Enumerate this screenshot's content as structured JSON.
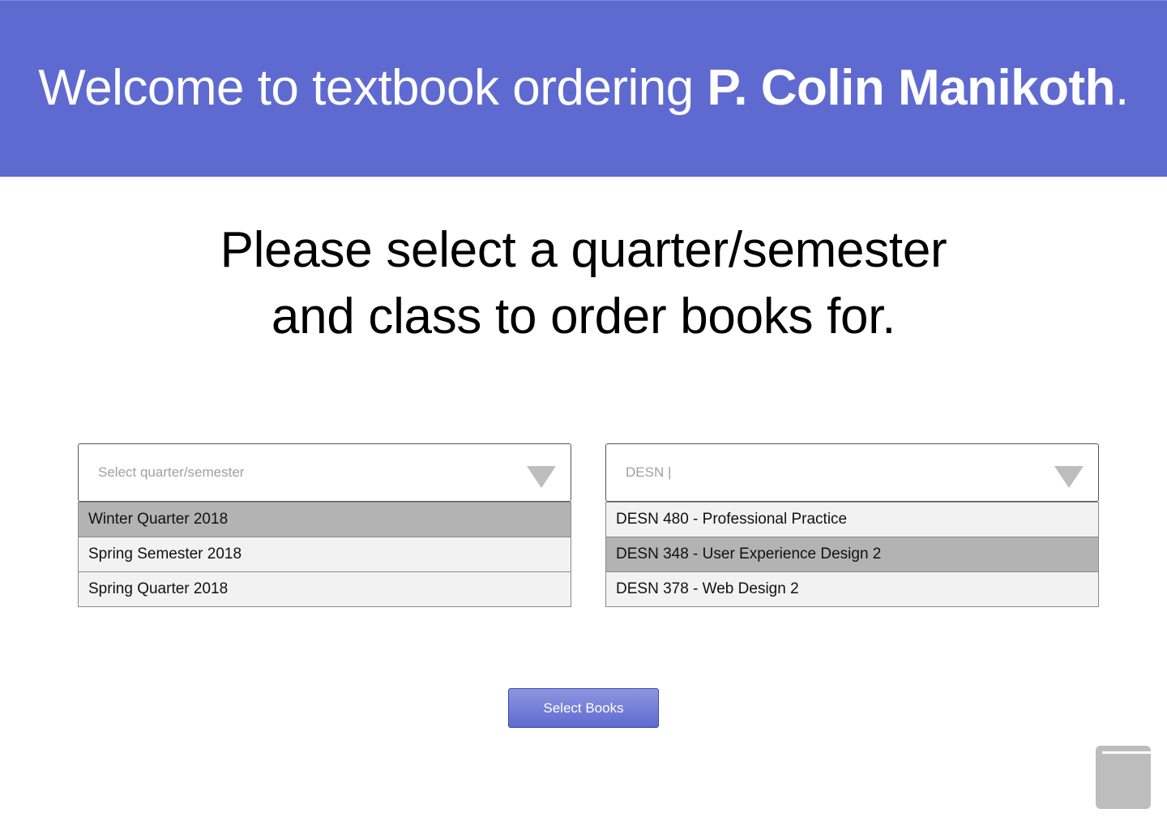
{
  "header": {
    "welcome_text": "Welcome to textbook ordering ",
    "user_name": "P. Colin Manikoth",
    "punctuation": "."
  },
  "instructions": {
    "line1": "Please select a quarter/semester",
    "line2": "and class to order books for."
  },
  "term_dropdown": {
    "placeholder": "Select quarter/semester",
    "options": [
      {
        "label": "Winter Quarter 2018",
        "selected": true
      },
      {
        "label": "Spring Semester 2018",
        "selected": false
      },
      {
        "label": "Spring Quarter 2018",
        "selected": false
      }
    ]
  },
  "class_dropdown": {
    "value": "DESN |",
    "options": [
      {
        "label": "DESN 480 - Professional Practice",
        "selected": false
      },
      {
        "label": "DESN 348 - User Experience Design 2",
        "selected": true
      },
      {
        "label": "DESN 378 - Web Design 2",
        "selected": false
      }
    ]
  },
  "actions": {
    "select_books_label": "Select Books"
  },
  "icons": {
    "dropdown_arrow": "chevron-down-icon",
    "corner": "book-icon"
  },
  "colors": {
    "header_bg": "#5f6ad1",
    "selected_option_bg": "#b3b3b3",
    "option_bg": "#f2f2f2",
    "button_bg": "#5f6ad1"
  }
}
